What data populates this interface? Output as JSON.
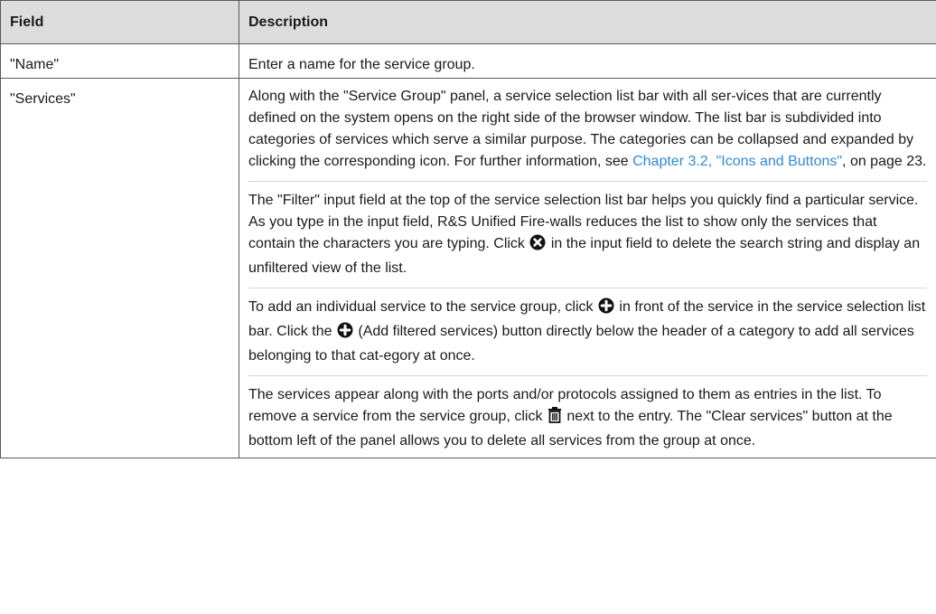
{
  "table": {
    "header": {
      "field": "Field",
      "description": "Description"
    },
    "rows": [
      {
        "field": "\"Name\"",
        "description": "Enter a name for the service group."
      },
      {
        "field": "\"Services\""
      }
    ]
  },
  "services": {
    "p1": {
      "text_before_link": "Along with the \"Service Group\" panel, a service selection list bar with all ser-vices that are currently defined on the system opens on the right side of the browser window. The list bar is subdivided into categories of services which serve a similar purpose. The categories can be collapsed and expanded by clicking the corresponding icon. For further information, see ",
      "link_text": "Chapter 3.2, \"Icons and Buttons\"",
      "text_after_link": ", on page 23."
    },
    "p2": {
      "before_icon": "The \"Filter\" input field at the top of the service selection list bar helps you quickly find a particular service. As you type in the input field, R&S Unified Fire-walls reduces the list to show only the services that contain the characters you are typing. Click ",
      "icon": "clear-x-circle-icon",
      "after_icon": " in the input field to delete the search string and display an unfiltered view of the list."
    },
    "p3": {
      "before_icon1": "To add an individual service to the service group, click ",
      "icon1": "plus-circle-icon",
      "middle": " in front of the service in the service selection list bar. Click the ",
      "icon2": "plus-circle-icon",
      "after_icon2": " (Add filtered services) button directly below the header of a category to add all services belonging to that cat-egory at once."
    },
    "p4": {
      "before_icon": "The services appear along with the ports and/or protocols assigned to them as entries in the list. To remove a service from the service group, click ",
      "icon": "trash-icon",
      "after_icon": " next to the entry. The \"Clear services\" button at the bottom left of the panel allows you to delete all services from the group at once."
    }
  }
}
